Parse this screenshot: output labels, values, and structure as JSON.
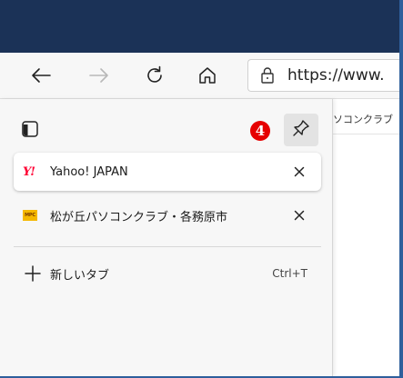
{
  "toolbar": {
    "back_icon": "back-arrow-icon",
    "forward_icon": "forward-arrow-icon",
    "refresh_icon": "refresh-icon",
    "home_icon": "home-icon",
    "address": {
      "lock_icon": "lock-icon",
      "url": "https://www."
    }
  },
  "page": {
    "tab_fragment": "ソコンクラブ"
  },
  "tab_pane": {
    "header_icon": "tab-actions-icon",
    "step_badge": "4",
    "pin_icon": "pin-icon",
    "tabs": [
      {
        "favicon_text": "Y!",
        "title": "Yahoo! JAPAN",
        "active": true
      },
      {
        "favicon_text": "MPC",
        "title": "松が丘パソコンクラブ・各務原市",
        "active": false
      }
    ],
    "new_tab": {
      "label": "新しいタブ",
      "shortcut": "Ctrl+T"
    }
  },
  "colors": {
    "titlebar": "#1b3257",
    "window_border": "#2e5f9c",
    "badge": "#e60000",
    "yahoo_red": "#ff0033",
    "mpc_yellow": "#f5b800"
  }
}
